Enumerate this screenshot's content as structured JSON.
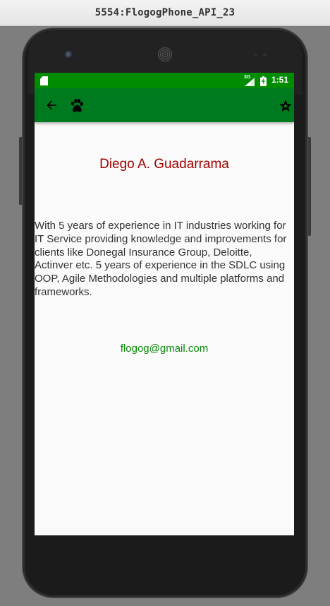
{
  "window": {
    "title": "5554:FlogogPhone_API_23"
  },
  "status_bar": {
    "network": "3G",
    "time": "1:51",
    "color": "#008c00",
    "icons": [
      "sd-card-icon",
      "signal-icon",
      "battery-charging-icon"
    ]
  },
  "app_bar": {
    "color": "#007a1f",
    "icons": [
      "back-arrow-icon",
      "paw-icon",
      "star-badge-icon"
    ]
  },
  "profile": {
    "name": "Diego A. Guadarrama",
    "name_color": "#a30000",
    "bio": "With 5 years of experience in IT industries working for IT Service providing knowledge and improvements for clients like Donegal Insurance Group, Deloitte, Actinver etc. 5 years of experience in the SDLC using OOP, Agile Methodologies and multiple platforms and frameworks.",
    "email": "flogog@gmail.com",
    "email_color": "#0b8a0b"
  }
}
